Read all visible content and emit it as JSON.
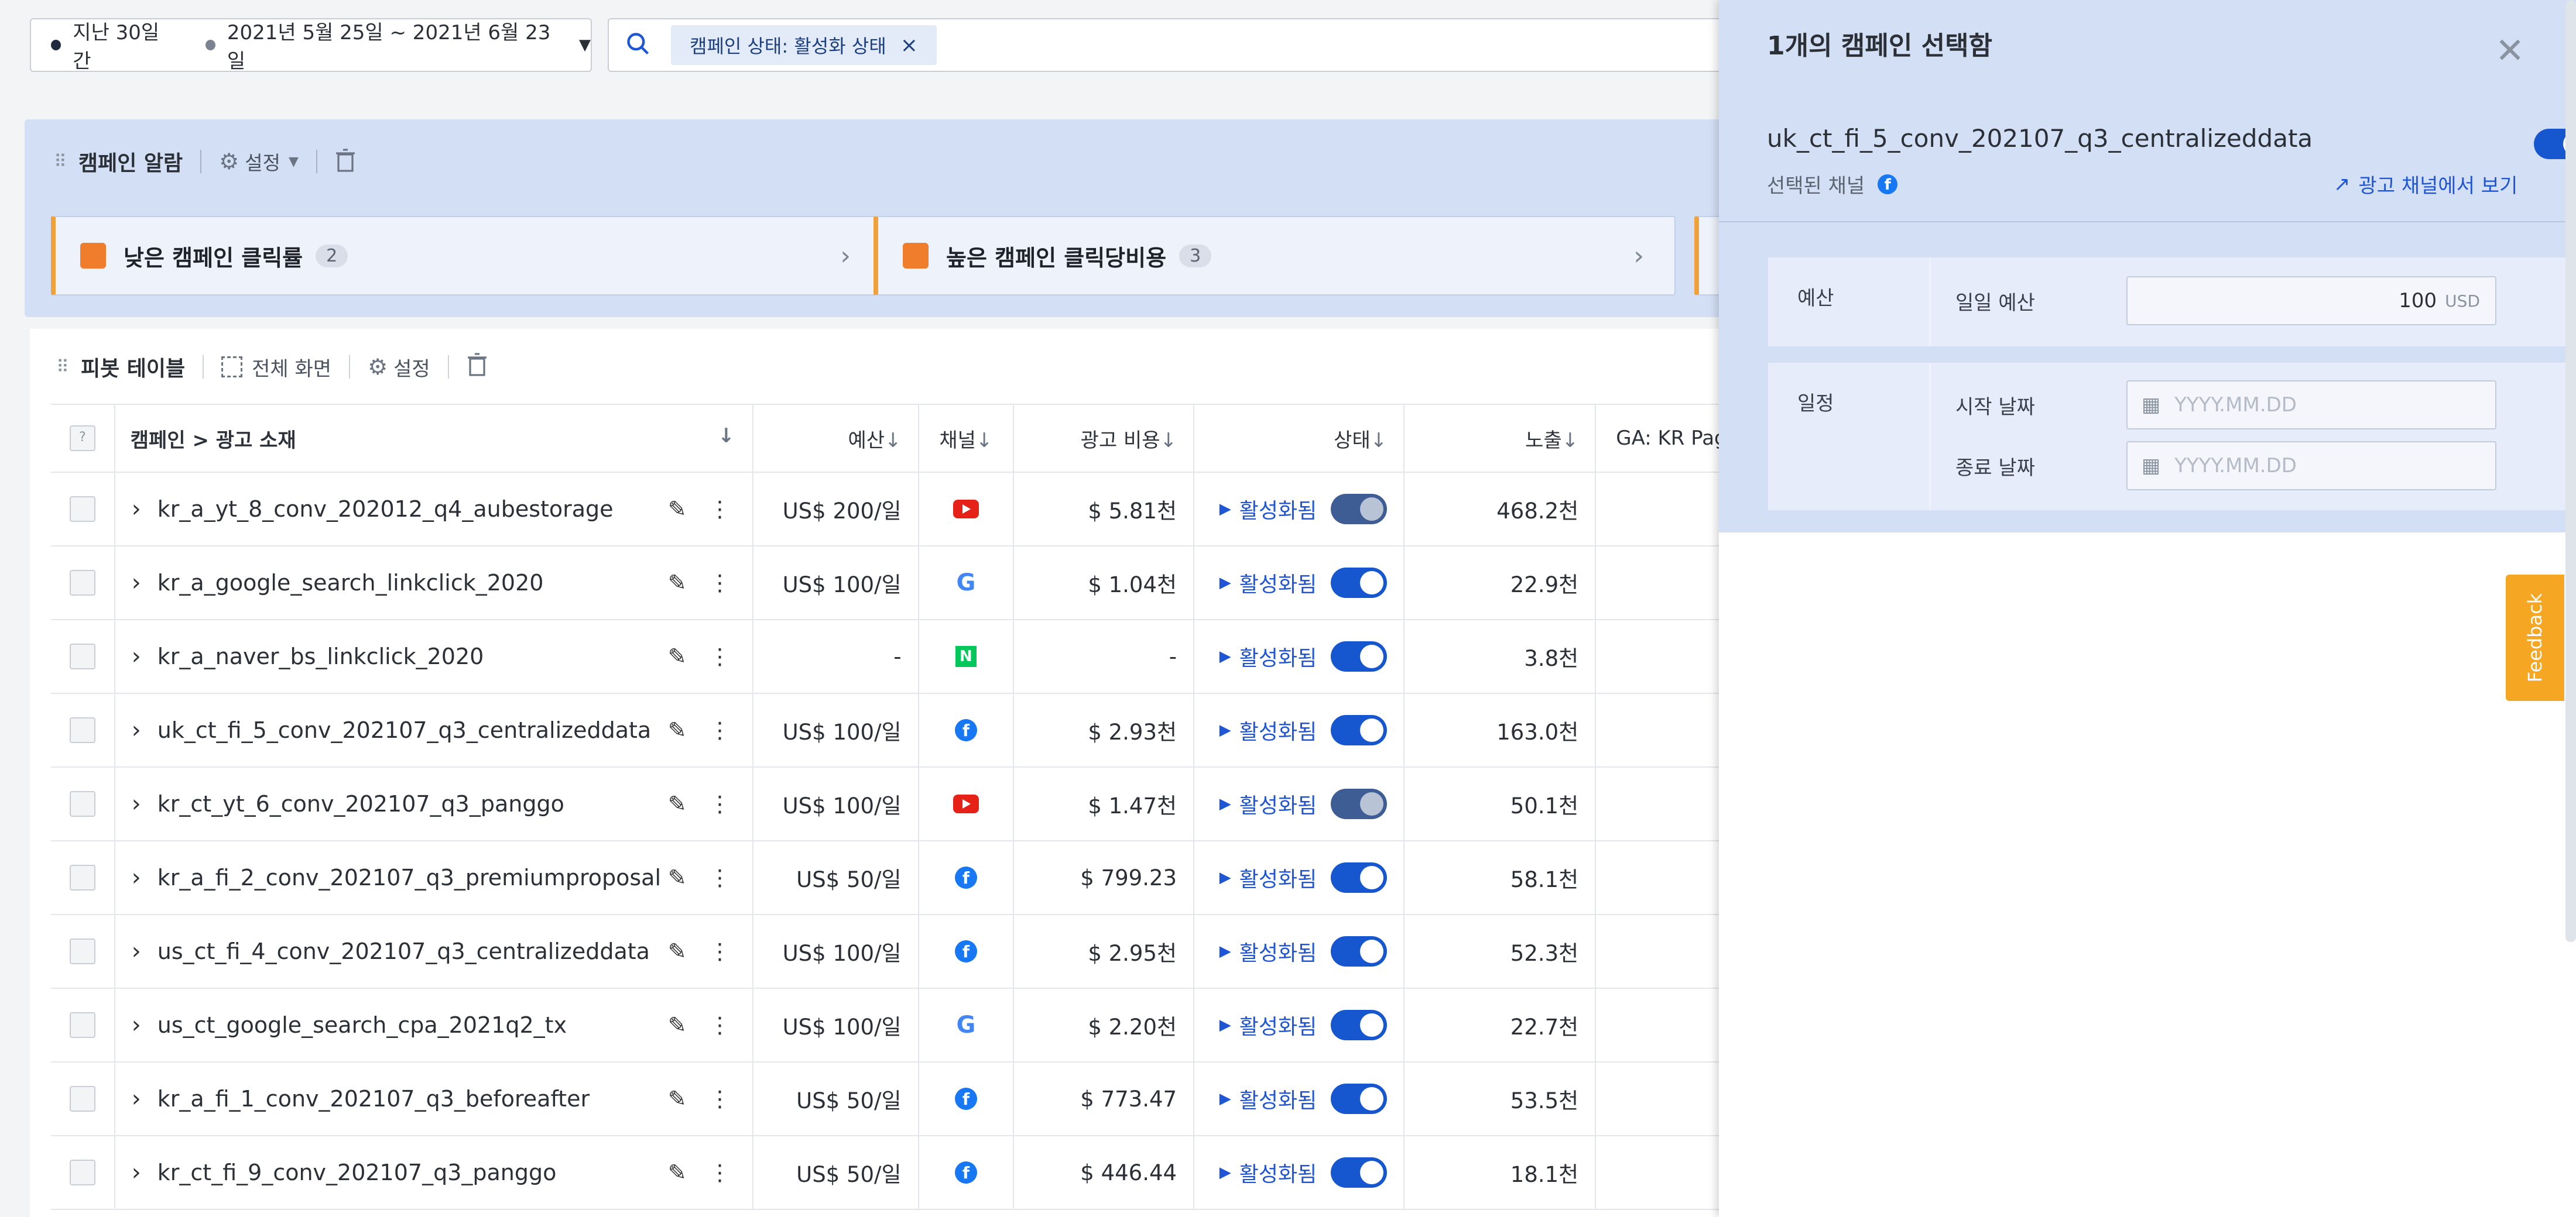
{
  "date_filter": {
    "period": "지난 30일간",
    "range": "2021년 5월 25일 ~ 2021년 6월 23일"
  },
  "filter": {
    "chip": "캠페인 상태: 활성화 상태"
  },
  "alarm": {
    "title": "캠페인 알람",
    "settings": "설정",
    "cards": [
      {
        "label": "낮은 캠페인 클릭률",
        "count": "2"
      },
      {
        "label": "높은 캠페인 클릭당비용",
        "count": "3"
      }
    ]
  },
  "pivot": {
    "title": "피봇 테이블",
    "fullscreen": "전체 화면",
    "settings": "설정",
    "columns": {
      "select": "?",
      "campaign": "캠페인 > 광고 소재",
      "budget": "예산",
      "channel": "채널",
      "cost": "광고 비용",
      "status": "상태",
      "impressions": "노출",
      "ga": "GA: KR Page"
    },
    "rows": [
      {
        "name": "kr_a_yt_8_conv_202012_q4_aubestorage",
        "budget": "US$ 200/일",
        "channel": "youtube",
        "cost": "$ 5.81천",
        "status": "활성화됨",
        "impressions": "468.2천",
        "toggle_dim": true
      },
      {
        "name": "kr_a_google_search_linkclick_2020",
        "budget": "US$ 100/일",
        "channel": "google",
        "cost": "$ 1.04천",
        "status": "활성화됨",
        "impressions": "22.9천",
        "toggle_dim": false
      },
      {
        "name": "kr_a_naver_bs_linkclick_2020",
        "budget": "-",
        "channel": "naver",
        "cost": "-",
        "status": "활성화됨",
        "impressions": "3.8천",
        "toggle_dim": false
      },
      {
        "name": "uk_ct_fi_5_conv_202107_q3_centralizeddata",
        "budget": "US$ 100/일",
        "channel": "facebook",
        "cost": "$ 2.93천",
        "status": "활성화됨",
        "impressions": "163.0천",
        "toggle_dim": false
      },
      {
        "name": "kr_ct_yt_6_conv_202107_q3_panggo",
        "budget": "US$ 100/일",
        "channel": "youtube",
        "cost": "$ 1.47천",
        "status": "활성화됨",
        "impressions": "50.1천",
        "toggle_dim": true
      },
      {
        "name": "kr_a_fi_2_conv_202107_q3_premiumproposal",
        "budget": "US$ 50/일",
        "channel": "facebook",
        "cost": "$ 799.23",
        "status": "활성화됨",
        "impressions": "58.1천",
        "toggle_dim": false
      },
      {
        "name": "us_ct_fi_4_conv_202107_q3_centralizeddata",
        "budget": "US$ 100/일",
        "channel": "facebook",
        "cost": "$ 2.95천",
        "status": "활성화됨",
        "impressions": "52.3천",
        "toggle_dim": false
      },
      {
        "name": "us_ct_google_search_cpa_2021q2_tx",
        "budget": "US$ 100/일",
        "channel": "google",
        "cost": "$ 2.20천",
        "status": "활성화됨",
        "impressions": "22.7천",
        "toggle_dim": false
      },
      {
        "name": "kr_a_fi_1_conv_202107_q3_beforeafter",
        "budget": "US$ 50/일",
        "channel": "facebook",
        "cost": "$ 773.47",
        "status": "활성화됨",
        "impressions": "53.5천",
        "toggle_dim": false
      },
      {
        "name": "kr_ct_fi_9_conv_202107_q3_panggo",
        "budget": "US$ 50/일",
        "channel": "facebook",
        "cost": "$ 446.44",
        "status": "활성화됨",
        "impressions": "18.1천",
        "toggle_dim": false
      }
    ]
  },
  "panel": {
    "title": "1개의 캠페인 선택함",
    "campaign_name": "uk_ct_fi_5_conv_202107_q3_centralizeddata",
    "selected_channel_label": "선택된 채널",
    "view_in_channel": "광고 채널에서 보기",
    "budget_section": "예산",
    "daily_budget_label": "일일 예산",
    "daily_budget_value": "100",
    "currency": "USD",
    "schedule_section": "일정",
    "start_date_label": "시작 날짜",
    "end_date_label": "종료 날짜",
    "date_placeholder": "YYYY.MM.DD"
  },
  "feedback": "Feedback",
  "colors": {
    "accent": "#1657cf",
    "youtube": "#e62117",
    "google": "#4285f4",
    "naver": "#03c75a",
    "facebook": "#1877f2",
    "alarm_orange": "#ef7d2b",
    "feedback": "#f5a623"
  }
}
